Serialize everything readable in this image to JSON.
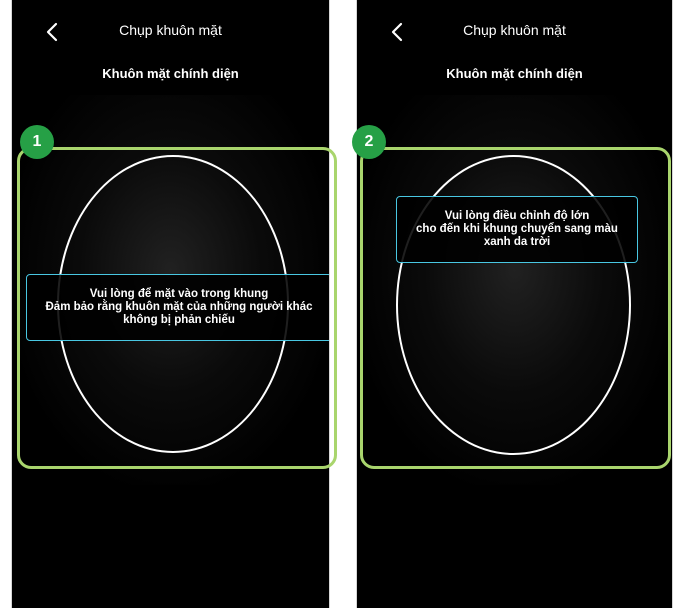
{
  "screens": [
    {
      "title": "Chụp khuôn mặt",
      "subtitle": "Khuôn mặt chính diện",
      "hint_lines": [
        "Vui lòng để mặt vào trong khung",
        "Đảm bảo rằng khuôn mặt của những người khác",
        "không bị phản chiếu"
      ]
    },
    {
      "title": "Chụp khuôn mặt",
      "subtitle": "Khuôn mặt chính diện",
      "hint_lines": [
        "Vui lòng điều chỉnh độ lớn",
        "cho đến khi khung chuyển sang màu",
        "xanh da trời"
      ]
    }
  ],
  "steps": [
    "1",
    "2"
  ],
  "colors": {
    "screen_background": "#000000",
    "oval_stroke": "#ffffff",
    "hint_border": "#49c7e2",
    "callout_border": "#a9d56d",
    "step_badge": "#26a046"
  },
  "icons": {
    "back": "chevron-left-icon"
  }
}
